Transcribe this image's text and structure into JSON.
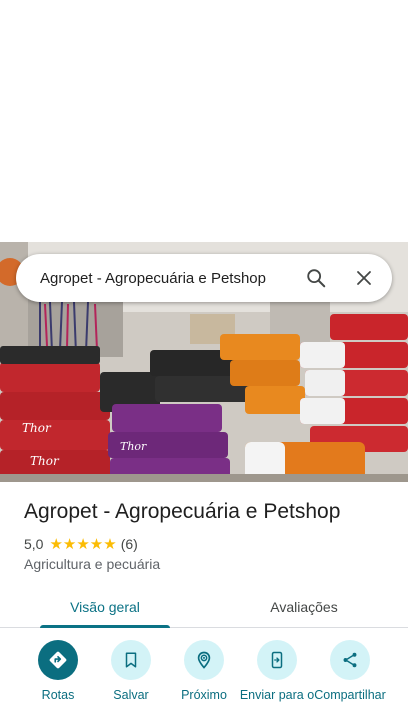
{
  "search": {
    "query": "Agropet - Agropecuária e Petshop"
  },
  "place": {
    "name": "Agropet - Agropecuária e Petshop",
    "rating": "5,0",
    "rating_value": 5.0,
    "stars": "★★★★★",
    "review_count": "(6)",
    "category": "Agricultura e pecuária"
  },
  "tabs": [
    {
      "label": "Visão geral",
      "active": true
    },
    {
      "label": "Avaliações",
      "active": false
    }
  ],
  "actions": [
    {
      "label": "Rotas",
      "icon": "directions-icon"
    },
    {
      "label": "Salvar",
      "icon": "bookmark-icon"
    },
    {
      "label": "Próximo",
      "icon": "nearby-icon"
    },
    {
      "label": "Enviar para o",
      "icon": "send-to-phone-icon"
    },
    {
      "label": "Compartilhar",
      "icon": "share-icon"
    }
  ],
  "colors": {
    "accent": "#0b6e80",
    "action_bg": "#d3f3f7",
    "star": "#fbbc04"
  }
}
